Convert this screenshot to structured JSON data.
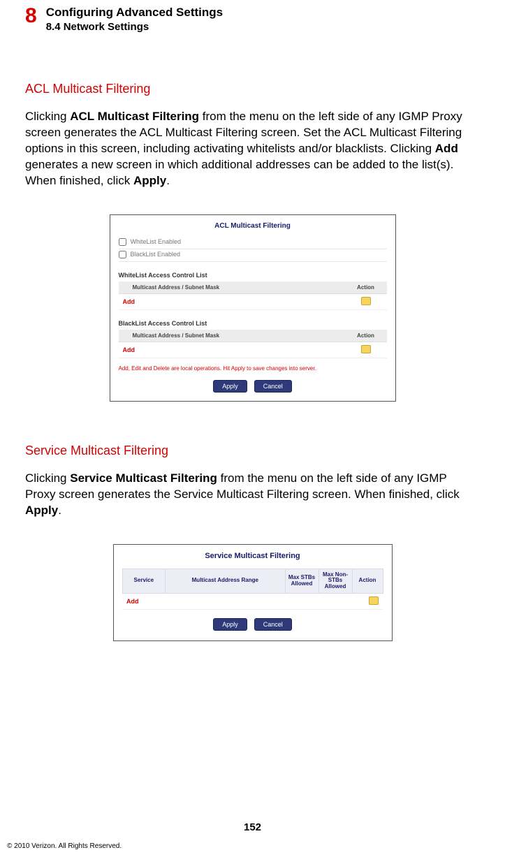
{
  "chapter": {
    "number": "8",
    "title": "Configuring Advanced Settings",
    "subsection": "8.4  Network Settings"
  },
  "section1": {
    "heading": "ACL Multicast Filtering",
    "para_parts": {
      "p1": "Clicking ",
      "b1": "ACL Multicast Filtering",
      "p2": " from the menu on the left side of any IGMP Proxy screen generates the ACL Multicast Filtering screen. Set the ACL Multicast Filtering options in this screen, including activating whitelists and/or blacklists. Clicking ",
      "b2": "Add",
      "p3": " generates a new screen in which additional addresses can be added to the list(s). When finished, click ",
      "b3": "Apply",
      "p4": "."
    },
    "figure": {
      "title": "ACL Multicast Filtering",
      "whitelist_enabled": "WhiteList Enabled",
      "blacklist_enabled": "BlackList Enabled",
      "whitelist_header": "WhiteList Access Control List",
      "blacklist_header": "BlackList Access Control List",
      "col_addr": "Multicast Address / Subnet Mask",
      "col_action": "Action",
      "add": "Add",
      "note": "Add, Edit and Delete are local operations. Hit Apply to save changes into server.",
      "apply": "Apply",
      "cancel": "Cancel"
    }
  },
  "section2": {
    "heading": "Service Multicast Filtering",
    "para_parts": {
      "p1": "Clicking ",
      "b1": "Service Multicast Filtering",
      "p2": " from the menu on the left side of any IGMP Proxy screen generates the Service Multicast Filtering screen. When finished, click ",
      "b2": "Apply",
      "p3": "."
    },
    "figure": {
      "title": "Service Multicast Filtering",
      "col_service": "Service",
      "col_range": "Multicast Address Range",
      "col_max_stb": "Max STBs Allowed",
      "col_max_nonstb": "Max Non-STBs Allowed",
      "col_action": "Action",
      "add": "Add",
      "apply": "Apply",
      "cancel": "Cancel"
    }
  },
  "page_number": "152",
  "copyright": "© 2010 Verizon. All Rights Reserved."
}
